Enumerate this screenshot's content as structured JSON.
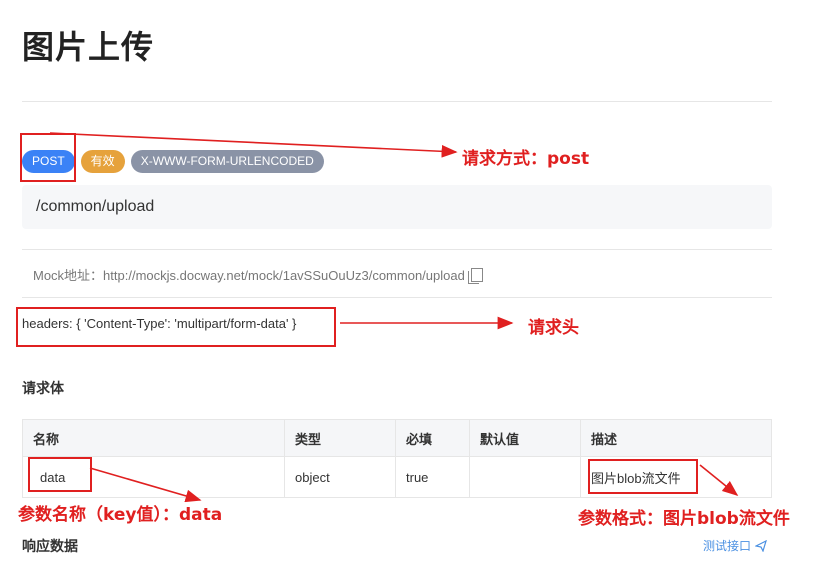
{
  "page": {
    "title": "图片上传"
  },
  "tags": {
    "method": "POST",
    "status": "有效",
    "encoding": "X-WWW-FORM-URLENCODED"
  },
  "endpoint": {
    "path": "/common/upload"
  },
  "mock": {
    "text": "Mock地址：http://mockjs.docway.net/mock/1avSSuOuUz3/common/upload"
  },
  "headers_text": "headers: { 'Content-Type': 'multipart/form-data' }",
  "sections": {
    "request_body": "请求体",
    "response": "响应数据"
  },
  "table": {
    "headers": [
      "名称",
      "类型",
      "必填",
      "默认值",
      "描述"
    ],
    "rows": [
      [
        "data",
        "object",
        "true",
        "",
        "图片blob流文件"
      ]
    ]
  },
  "test_link": "测试接口",
  "annotations": {
    "method": "请求方式：post",
    "header": "请求头",
    "key": "参数名称（key值）：data",
    "format": "参数格式：图片blob流文件"
  },
  "colors": {
    "annotation": "#e02020",
    "post": "#3b82f6",
    "valid": "#e6a23c",
    "encoding": "#8a93a6",
    "link": "#4a90e2"
  }
}
